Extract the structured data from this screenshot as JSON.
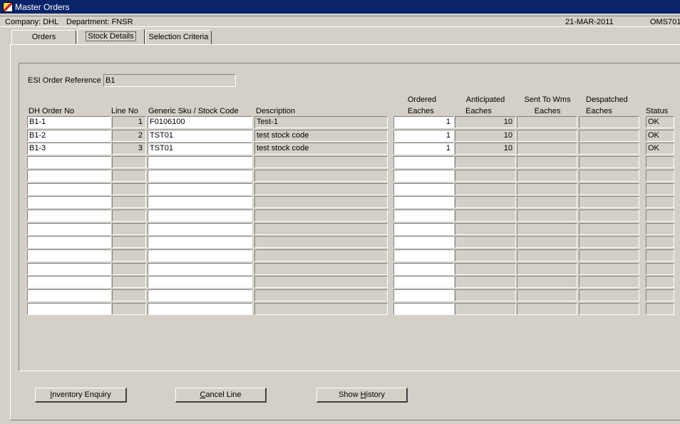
{
  "window": {
    "title": "Master Orders",
    "icon": "oracle-forms-icon"
  },
  "infobar": {
    "company": "Company:  DHL",
    "department": "Department:  FNSR",
    "date": "21-MAR-2011",
    "form_code": "OMS701"
  },
  "tabs": [
    {
      "label": "Orders",
      "active": false
    },
    {
      "label": "Stock Details",
      "active": true
    },
    {
      "label": "Selection Criteria",
      "active": false
    }
  ],
  "esi": {
    "label": "ESI Order Reference",
    "value": "B1"
  },
  "columns": {
    "dh_order_no": "DH Order No",
    "line_no": "Line No",
    "sku": "Generic Sku / Stock Code",
    "description": "Description",
    "ordered_1": "Ordered",
    "ordered_2": "Eaches",
    "anticipated_1": "Anticipated",
    "anticipated_2": "Eaches",
    "sent_1": "Sent To Wms",
    "sent_2": "Eaches",
    "despatched_1": "Despatched",
    "despatched_2": "Eaches",
    "status": "Status"
  },
  "rows": [
    {
      "dh_order_no": "B1-1",
      "line_no": "1",
      "sku": "F0106100",
      "description": "Test-1",
      "ordered": "1",
      "anticipated": "10",
      "sent": "",
      "despatched": "",
      "status": "OK"
    },
    {
      "dh_order_no": "B1-2",
      "line_no": "2",
      "sku": "TST01",
      "description": "test stock code",
      "ordered": "1",
      "anticipated": "10",
      "sent": "",
      "despatched": "",
      "status": "OK"
    },
    {
      "dh_order_no": "B1-3",
      "line_no": "3",
      "sku": "TST01",
      "description": "test stock code",
      "ordered": "1",
      "anticipated": "10",
      "sent": "",
      "despatched": "",
      "status": "OK"
    },
    {
      "dh_order_no": "",
      "line_no": "",
      "sku": "",
      "description": "",
      "ordered": "",
      "anticipated": "",
      "sent": "",
      "despatched": "",
      "status": ""
    },
    {
      "dh_order_no": "",
      "line_no": "",
      "sku": "",
      "description": "",
      "ordered": "",
      "anticipated": "",
      "sent": "",
      "despatched": "",
      "status": ""
    },
    {
      "dh_order_no": "",
      "line_no": "",
      "sku": "",
      "description": "",
      "ordered": "",
      "anticipated": "",
      "sent": "",
      "despatched": "",
      "status": ""
    },
    {
      "dh_order_no": "",
      "line_no": "",
      "sku": "",
      "description": "",
      "ordered": "",
      "anticipated": "",
      "sent": "",
      "despatched": "",
      "status": ""
    },
    {
      "dh_order_no": "",
      "line_no": "",
      "sku": "",
      "description": "",
      "ordered": "",
      "anticipated": "",
      "sent": "",
      "despatched": "",
      "status": ""
    },
    {
      "dh_order_no": "",
      "line_no": "",
      "sku": "",
      "description": "",
      "ordered": "",
      "anticipated": "",
      "sent": "",
      "despatched": "",
      "status": ""
    },
    {
      "dh_order_no": "",
      "line_no": "",
      "sku": "",
      "description": "",
      "ordered": "",
      "anticipated": "",
      "sent": "",
      "despatched": "",
      "status": ""
    },
    {
      "dh_order_no": "",
      "line_no": "",
      "sku": "",
      "description": "",
      "ordered": "",
      "anticipated": "",
      "sent": "",
      "despatched": "",
      "status": ""
    },
    {
      "dh_order_no": "",
      "line_no": "",
      "sku": "",
      "description": "",
      "ordered": "",
      "anticipated": "",
      "sent": "",
      "despatched": "",
      "status": ""
    },
    {
      "dh_order_no": "",
      "line_no": "",
      "sku": "",
      "description": "",
      "ordered": "",
      "anticipated": "",
      "sent": "",
      "despatched": "",
      "status": ""
    },
    {
      "dh_order_no": "",
      "line_no": "",
      "sku": "",
      "description": "",
      "ordered": "",
      "anticipated": "",
      "sent": "",
      "despatched": "",
      "status": ""
    },
    {
      "dh_order_no": "",
      "line_no": "",
      "sku": "",
      "description": "",
      "ordered": "",
      "anticipated": "",
      "sent": "",
      "despatched": "",
      "status": ""
    }
  ],
  "buttons": {
    "inventory_enquiry": "Inventory Enquiry",
    "cancel_line": "Cancel Line",
    "show_history": "Show History"
  },
  "colors": {
    "title_bar": "#0a246a",
    "face": "#d4d0c8"
  }
}
